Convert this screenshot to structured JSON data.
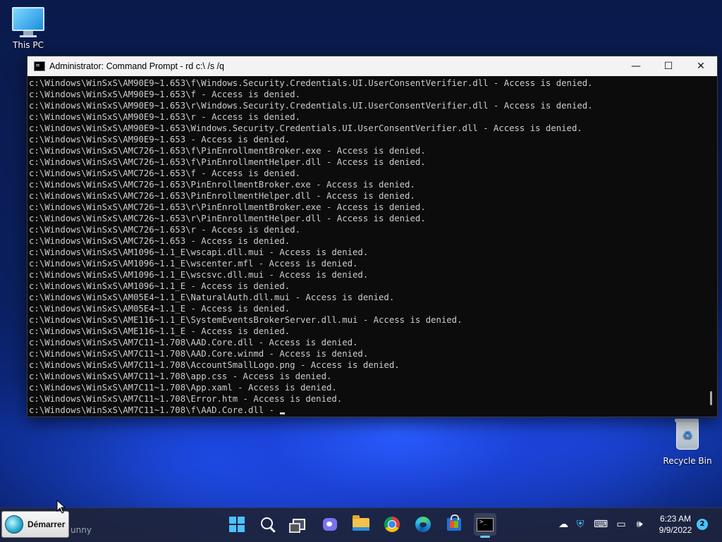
{
  "desktop": {
    "this_pc_label": "This PC",
    "recycle_bin_label": "Recycle Bin"
  },
  "window": {
    "title": "Administrator: Command Prompt - rd  c:\\ /s /q",
    "minimize_glyph": "—",
    "maximize_glyph": "☐",
    "close_glyph": "✕",
    "lines": [
      "c:\\Windows\\WinSxS\\AM90E9~1.653\\f\\Windows.Security.Credentials.UI.UserConsentVerifier.dll - Access is denied.",
      "c:\\Windows\\WinSxS\\AM90E9~1.653\\f - Access is denied.",
      "c:\\Windows\\WinSxS\\AM90E9~1.653\\r\\Windows.Security.Credentials.UI.UserConsentVerifier.dll - Access is denied.",
      "c:\\Windows\\WinSxS\\AM90E9~1.653\\r - Access is denied.",
      "c:\\Windows\\WinSxS\\AM90E9~1.653\\Windows.Security.Credentials.UI.UserConsentVerifier.dll - Access is denied.",
      "c:\\Windows\\WinSxS\\AM90E9~1.653 - Access is denied.",
      "c:\\Windows\\WinSxS\\AMC726~1.653\\f\\PinEnrollmentBroker.exe - Access is denied.",
      "c:\\Windows\\WinSxS\\AMC726~1.653\\f\\PinEnrollmentHelper.dll - Access is denied.",
      "c:\\Windows\\WinSxS\\AMC726~1.653\\f - Access is denied.",
      "c:\\Windows\\WinSxS\\AMC726~1.653\\PinEnrollmentBroker.exe - Access is denied.",
      "c:\\Windows\\WinSxS\\AMC726~1.653\\PinEnrollmentHelper.dll - Access is denied.",
      "c:\\Windows\\WinSxS\\AMC726~1.653\\r\\PinEnrollmentBroker.exe - Access is denied.",
      "c:\\Windows\\WinSxS\\AMC726~1.653\\r\\PinEnrollmentHelper.dll - Access is denied.",
      "c:\\Windows\\WinSxS\\AMC726~1.653\\r - Access is denied.",
      "c:\\Windows\\WinSxS\\AMC726~1.653 - Access is denied.",
      "c:\\Windows\\WinSxS\\AM1096~1.1_E\\wscapi.dll.mui - Access is denied.",
      "c:\\Windows\\WinSxS\\AM1096~1.1_E\\wscenter.mfl - Access is denied.",
      "c:\\Windows\\WinSxS\\AM1096~1.1_E\\wscsvc.dll.mui - Access is denied.",
      "c:\\Windows\\WinSxS\\AM1096~1.1_E - Access is denied.",
      "c:\\Windows\\WinSxS\\AM05E4~1.1_E\\NaturalAuth.dll.mui - Access is denied.",
      "c:\\Windows\\WinSxS\\AM05E4~1.1_E - Access is denied.",
      "c:\\Windows\\WinSxS\\AME116~1.1_E\\SystemEventsBrokerServer.dll.mui - Access is denied.",
      "c:\\Windows\\WinSxS\\AME116~1.1_E - Access is denied.",
      "c:\\Windows\\WinSxS\\AM7C11~1.708\\AAD.Core.dll - Access is denied.",
      "c:\\Windows\\WinSxS\\AM7C11~1.708\\AAD.Core.winmd - Access is denied.",
      "c:\\Windows\\WinSxS\\AM7C11~1.708\\AccountSmallLogo.png - Access is denied.",
      "c:\\Windows\\WinSxS\\AM7C11~1.708\\app.css - Access is denied.",
      "c:\\Windows\\WinSxS\\AM7C11~1.708\\App.xaml - Access is denied.",
      "c:\\Windows\\WinSxS\\AM7C11~1.708\\Error.htm - Access is denied."
    ],
    "current_line": "c:\\Windows\\WinSxS\\AM7C11~1.708\\f\\AAD.Core.dll - "
  },
  "taskbar": {
    "start_classic_label": "Démarrer",
    "ghost_text": "unny",
    "icons": [
      "windows-start-icon",
      "search-icon",
      "task-view-icon",
      "chat-icon",
      "file-explorer-icon",
      "chrome-icon",
      "edge-icon",
      "store-icon",
      "command-prompt-icon"
    ],
    "time": "6:23 AM",
    "date": "9/9/2022",
    "notification_count": "2",
    "accent_color": "#4cc2ff"
  }
}
